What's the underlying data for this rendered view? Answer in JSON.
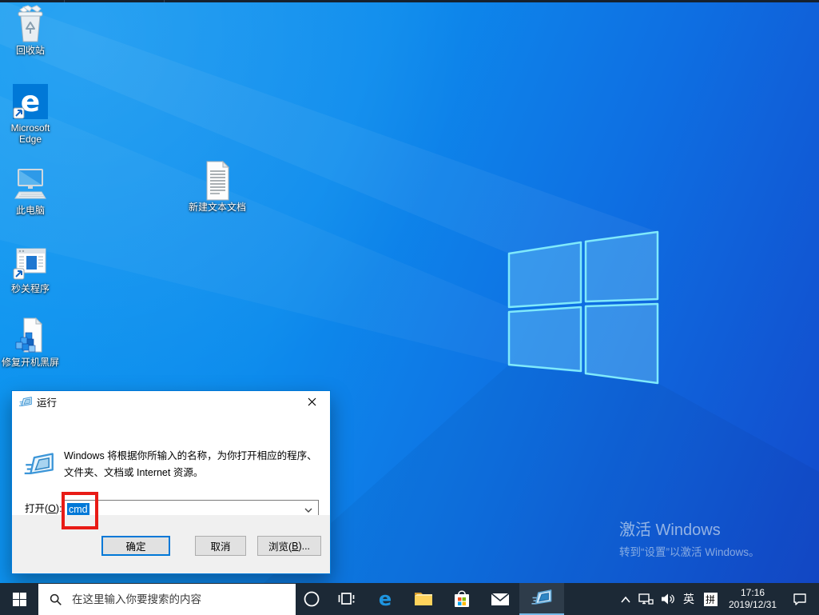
{
  "colors": {
    "accent": "#0078d7",
    "selection": "#0078d7",
    "taskbar_bg": "#1c2936",
    "taskbar_active_underline": "#76b9e8",
    "annotation_red": "#e81b16",
    "wallpaper_top_left": "#0c98f1",
    "wallpaper_bottom_right": "#1349cb",
    "dialog_footer": "#f0f0f0"
  },
  "desktop": {
    "icons": [
      {
        "name": "recycle-bin",
        "label": "回收站"
      },
      {
        "name": "microsoft-edge",
        "label": "Microsoft Edge"
      },
      {
        "name": "this-pc",
        "label": "此电脑"
      },
      {
        "name": "program-shortcut",
        "label": "秒关程序"
      },
      {
        "name": "registry-file",
        "label": "修复开机黑屏"
      }
    ],
    "new_text_doc": {
      "label": "新建文本文档"
    },
    "watermark": {
      "line1": "激活 Windows",
      "line2": "转到“设置”以激活 Windows。"
    }
  },
  "run_dialog": {
    "title": "运行",
    "description_line1": "Windows 将根据你所输入的名称，为你打开相应的程序、",
    "description_line2": "文件夹、文档或 Internet 资源。",
    "open_pre": "打开(",
    "open_key": "O",
    "open_post": "):",
    "input_value": "cmd",
    "ok_label": "确定",
    "cancel_label": "取消",
    "browse_pre": "浏览(",
    "browse_key": "B",
    "browse_post": ")..."
  },
  "taskbar": {
    "search_placeholder": "在这里输入你要搜索的内容",
    "items": [
      "start",
      "search",
      "cortana",
      "task-view",
      "edge",
      "file-explorer",
      "store",
      "mail",
      "run-active"
    ],
    "tray": {
      "ime_language": "英",
      "ime_mode": "拼",
      "time": "17:16",
      "date": "2019/12/31"
    }
  }
}
